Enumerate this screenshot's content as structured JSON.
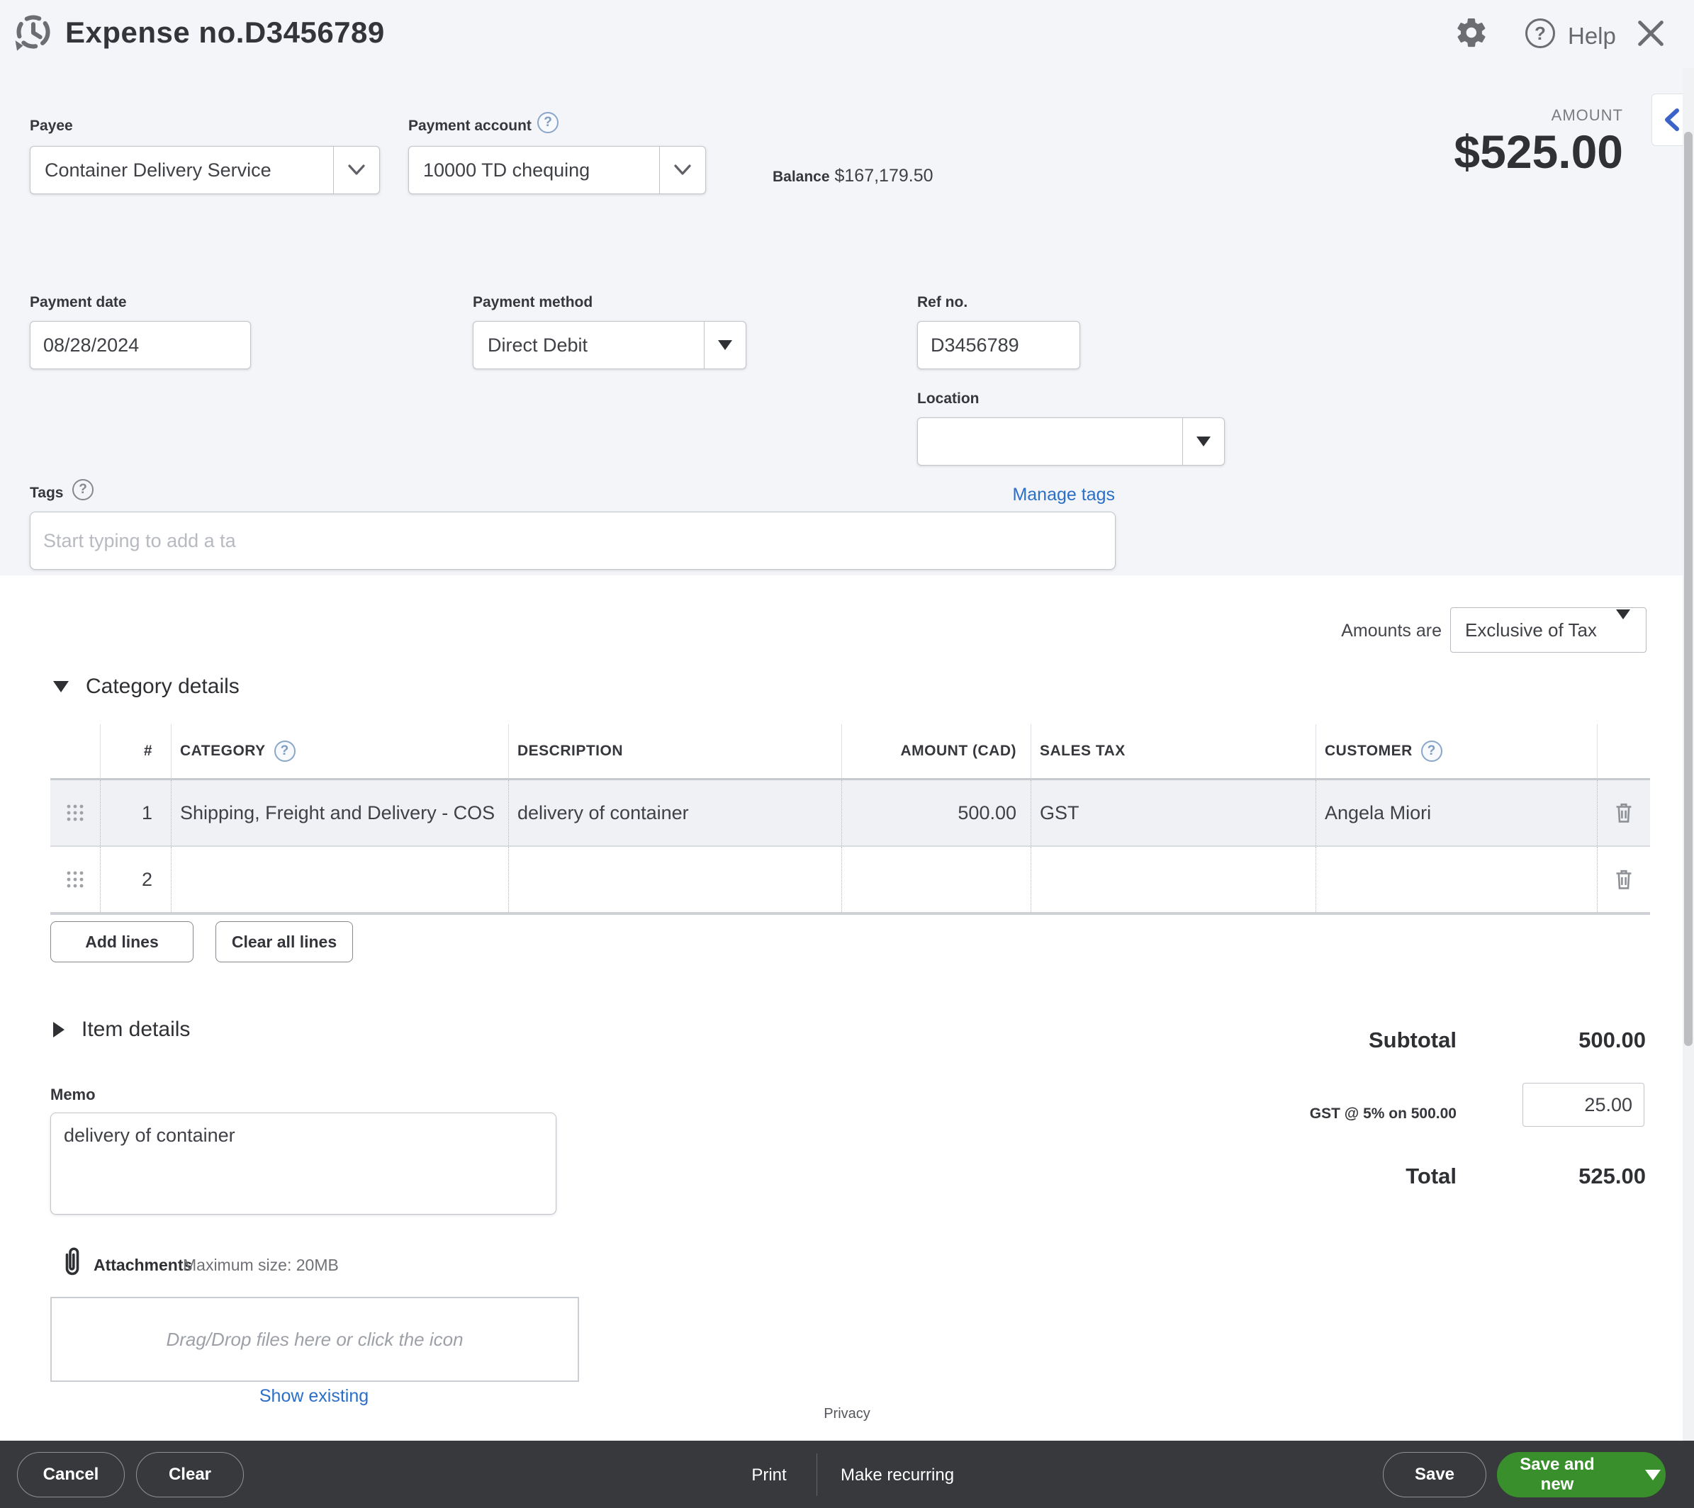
{
  "header": {
    "title": "Expense no.D3456789",
    "help_label": "Help"
  },
  "amount_panel": {
    "label": "AMOUNT",
    "value": "$525.00"
  },
  "form": {
    "payee": {
      "label": "Payee",
      "value": "Container Delivery Service"
    },
    "payment_account": {
      "label": "Payment account",
      "value": "10000 TD chequing"
    },
    "balance": {
      "label": "Balance",
      "value": "$167,179.50"
    },
    "payment_date": {
      "label": "Payment date",
      "value": "08/28/2024"
    },
    "payment_method": {
      "label": "Payment method",
      "value": "Direct Debit"
    },
    "ref_no": {
      "label": "Ref no.",
      "value": "D3456789"
    },
    "location": {
      "label": "Location",
      "value": ""
    },
    "tags": {
      "label": "Tags",
      "placeholder": "Start typing to add a ta",
      "manage_link": "Manage tags"
    }
  },
  "amounts_are": {
    "label": "Amounts are",
    "value": "Exclusive of Tax"
  },
  "category_details": {
    "title": "Category details",
    "columns": [
      "#",
      "CATEGORY",
      "DESCRIPTION",
      "AMOUNT (CAD)",
      "SALES TAX",
      "CUSTOMER"
    ],
    "rows": [
      {
        "num": "1",
        "category": "Shipping, Freight and Delivery - COS",
        "description": "delivery of container",
        "amount": "500.00",
        "sales_tax": "GST",
        "customer": "Angela Miori"
      },
      {
        "num": "2",
        "category": "",
        "description": "",
        "amount": "",
        "sales_tax": "",
        "customer": ""
      }
    ],
    "add_lines_label": "Add lines",
    "clear_all_label": "Clear all lines"
  },
  "item_details": {
    "title": "Item details"
  },
  "memo": {
    "label": "Memo",
    "value": "delivery of container"
  },
  "totals": {
    "subtotal_label": "Subtotal",
    "subtotal_value": "500.00",
    "tax_label": "GST @ 5% on 500.00",
    "tax_value": "25.00",
    "total_label": "Total",
    "total_value": "525.00"
  },
  "attachments": {
    "label": "Attachments",
    "max_size": "Maximum size: 20MB",
    "dropzone_text": "Drag/Drop files here or click the icon",
    "show_existing": "Show existing"
  },
  "privacy": "Privacy",
  "footer": {
    "cancel": "Cancel",
    "clear": "Clear",
    "print": "Print",
    "make_recurring": "Make recurring",
    "save": "Save",
    "save_and_new": "Save and new"
  },
  "colors": {
    "accent_green": "#3a8f2d",
    "link_blue": "#2b6fc7",
    "footer_bg": "#37393c",
    "section_bg": "#f4f5f8"
  }
}
